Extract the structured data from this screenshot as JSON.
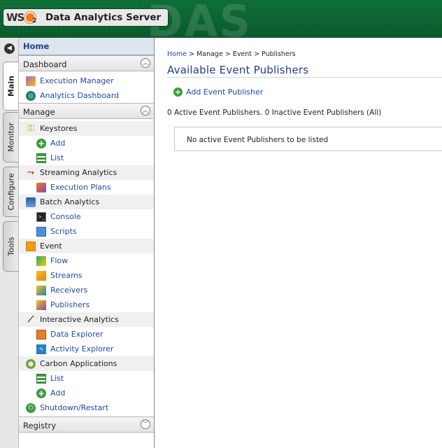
{
  "header": {
    "logo_text": "WSO2",
    "title": "Data Analytics Server",
    "background_word": "DAS"
  },
  "side_tabs": [
    {
      "label": "Main"
    },
    {
      "label": "Monitor"
    },
    {
      "label": "Configure"
    },
    {
      "label": "Tools"
    }
  ],
  "sidebar": {
    "home": "Home",
    "dashboard": {
      "label": "Dashboard",
      "items": [
        "Execution Manager",
        "Analytics Dashboard"
      ]
    },
    "manage": {
      "label": "Manage",
      "keystores": "Keystores",
      "keystores_add": "Add",
      "keystores_list": "List",
      "streaming": "Streaming Analytics",
      "execution_plans": "Execution Plans",
      "batch": "Batch Analytics",
      "console": "Console",
      "scripts": "Scripts",
      "event": "Event",
      "flow": "Flow",
      "streams": "Streams",
      "receivers": "Receivers",
      "publishers": "Publishers",
      "interactive": "Interactive Analytics",
      "data_explorer": "Data Explorer",
      "activity_explorer": "Activity Explorer",
      "carbon_apps": "Carbon Applications",
      "carbon_list": "List",
      "carbon_add": "Add",
      "shutdown": "Shutdown/Restart"
    },
    "registry": {
      "label": "Registry"
    }
  },
  "main": {
    "breadcrumb": {
      "home": "Home",
      "sep": " > ",
      "manage": "Manage",
      "event": "Event",
      "current": "Publishers"
    },
    "title": "Available Event Publishers",
    "add_link": "Add Event Publisher",
    "summary": "0 Active Event Publishers. 0 Inactive Event Publishers (All)",
    "empty_message": "No active Event Publishers to be listed"
  },
  "colors": {
    "header_green": "#0e6f37",
    "link_blue": "#1f4aa8",
    "title_blue": "#1f3f88"
  }
}
